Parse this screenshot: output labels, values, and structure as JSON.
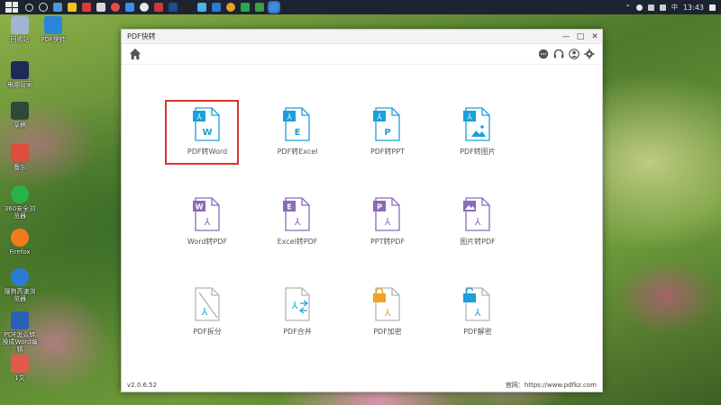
{
  "taskbar": {
    "time": "13:43"
  },
  "desktop": {
    "icons": [
      {
        "label": "回收站",
        "color": "#9fb5d0"
      },
      {
        "label": "PDF快转",
        "color": "#2a86d8"
      },
      {
        "label": "电脑管家",
        "color": "#1f2a5a"
      },
      {
        "label": "草稿",
        "color": "#2c4a3a"
      },
      {
        "label": "备忘",
        "color": "#e04c3c"
      },
      {
        "label": "360安全浏览器",
        "color": "#2bb24c"
      },
      {
        "label": "Firefox",
        "color": "#f57a1e"
      },
      {
        "label": "搜狗高速浏览器",
        "color": "#2a7dd6"
      },
      {
        "label": "PDF怎么转换成Word编辑",
        "color": "#2b5fb8"
      },
      {
        "label": "1文",
        "color": "#e05a4c"
      }
    ]
  },
  "window": {
    "title": "PDF快转",
    "controls": {
      "minimize": "—",
      "maximize": "□",
      "close": "✕"
    },
    "version": "v2.0.6.52",
    "website": "官网：https://www.pdfkz.com"
  },
  "colors": {
    "blue": "#1aa0da",
    "purple": "#8a6bb8",
    "orange": "#f0a22a",
    "gray": "#b5b5b5",
    "red_highlight": "#d9362f"
  },
  "tiles": [
    {
      "label": "PDF转Word",
      "letter": "W",
      "style": "blue-out"
    },
    {
      "label": "PDF转Excel",
      "letter": "E",
      "style": "blue-out"
    },
    {
      "label": "PDF转PPT",
      "letter": "P",
      "style": "blue-out"
    },
    {
      "label": "PDF转图片",
      "letter": "",
      "style": "blue-img"
    },
    {
      "label": "Word转PDF",
      "letter": "W",
      "style": "purple-in"
    },
    {
      "label": "Excel转PDF",
      "letter": "E",
      "style": "purple-in"
    },
    {
      "label": "PPT转PDF",
      "letter": "P",
      "style": "purple-in"
    },
    {
      "label": "图片转PDF",
      "letter": "",
      "style": "purple-img"
    },
    {
      "label": "PDF拆分",
      "letter": "",
      "style": "gray-split"
    },
    {
      "label": "PDF合并",
      "letter": "",
      "style": "gray-merge"
    },
    {
      "label": "PDF加密",
      "letter": "",
      "style": "lock-orange"
    },
    {
      "label": "PDF解密",
      "letter": "",
      "style": "lock-blue"
    }
  ]
}
